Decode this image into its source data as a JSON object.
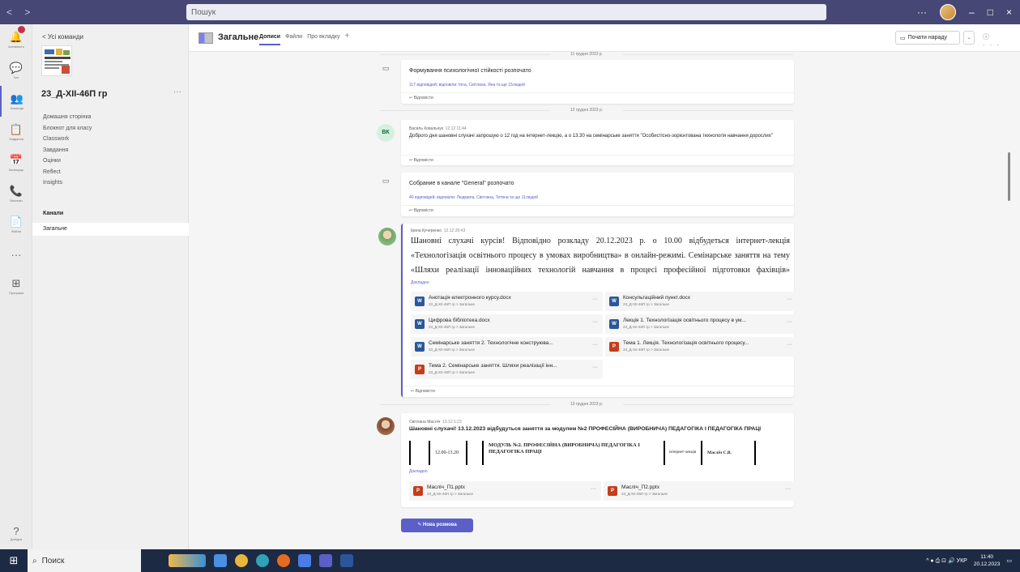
{
  "titlebar": {
    "nav": "< >",
    "search_placeholder": "Пошук",
    "more": "···",
    "min": "–",
    "max": "□",
    "close": "×"
  },
  "rail": {
    "items": [
      {
        "icon": "bell-icon",
        "glyph": "🔔",
        "label": "Активність"
      },
      {
        "icon": "chat-icon",
        "glyph": "💬",
        "label": "Чат"
      },
      {
        "icon": "teams-icon",
        "glyph": "👥",
        "label": "Команди"
      },
      {
        "icon": "assignments-icon",
        "glyph": "📋",
        "label": "Завдання"
      },
      {
        "icon": "calendar-icon",
        "glyph": "📅",
        "label": "Календар"
      },
      {
        "icon": "calls-icon",
        "glyph": "📞",
        "label": "Виклики"
      },
      {
        "icon": "files-icon",
        "glyph": "📄",
        "label": "Файли"
      },
      {
        "icon": "more-icon",
        "glyph": "···",
        "label": ""
      },
      {
        "icon": "apps-icon",
        "glyph": "⊞",
        "label": "Програми"
      }
    ],
    "help_glyph": "?",
    "help_label": "Довідка"
  },
  "sidebar": {
    "back": "< Усі команди",
    "team_name": "23_Д-ХІІ-46П гр",
    "more": "···",
    "items": [
      "Домашня сторінка",
      "Блокнот для класу",
      "Classwork",
      "Завдання",
      "Оцінки",
      "Reflect",
      "Insights"
    ],
    "channels_label": "Канали",
    "channel": "Загальне"
  },
  "header": {
    "title": "Загальне",
    "tabs": [
      "Дописи",
      "Файли",
      "Про вкладку"
    ],
    "add": "+",
    "meet": "Почати нараду",
    "drop": "⌄",
    "icons": "ⓘ ···"
  },
  "feed": {
    "dates": [
      "11 грудня 2023 р.",
      "12 грудня 2023 р.",
      "13 грудня 2023 р."
    ],
    "reply_label": "↩ Відповісти",
    "posts": [
      {
        "title": "Формування психологічної стійкості розпочато",
        "link": "117 відповідей; відповіли: Inna, Світлана, Яна та ще 15людей"
      },
      {
        "initials": "ВК",
        "author": "Василь Ковальчук",
        "time": "12.12 11:44",
        "text": "Доброго дня шановні слухачі запрошую о 12 год на інтернет-лекцію, а о 13.30 на семінарське заняття \"Особистісно-зорієнтована технологія навчання дорослих\""
      },
      {
        "title": "Собрание в канале \"General\" розпочато",
        "link": "40 відповідей; відповіли: Людмила, Світлана, Тетяна та ще 11людей"
      },
      {
        "author": "Ірина Кучеренко",
        "time": "12.12 20:43",
        "text": "Шановні слухачі курсів! Відповідно розкладу 20.12.2023 р. о 10.00 відбудеться інтернет-лекція «Технологізація освітнього процесу в умовах виробництва» в онлайн-режимі. Семінарське заняття на тему «Шляхи реалізації інноваційних технологій навчання в процесі професійної підготовки фахівців» відбудеться",
        "more": "Докладно",
        "files": [
          {
            "name": "Анотація електронного курсу.docx",
            "type": "W"
          },
          {
            "name": "Консультаційний пункт.docx",
            "type": "W"
          },
          {
            "name": "Цифрова бібліотека.docx",
            "type": "W"
          },
          {
            "name": "Лекція 1. Технологізація освітнього процесу в ум...",
            "type": "W"
          },
          {
            "name": "Семінарське заняття 2. Технологічне конструюва...",
            "type": "W"
          },
          {
            "name": "Тема 1. Лекція. Технологізація освітнього процесу...",
            "type": "P"
          },
          {
            "name": "Тема 2. Семінарське заняття. Шляхи реалізації інн...",
            "type": "P"
          }
        ],
        "file_path": "23_Д-ХІІ-46П гр > Загальне"
      },
      {
        "author": "Світлана Масліч",
        "time": "13.12 1:23",
        "text": "Шановні слухачі! 13.12.2023 відбудуться заняття за модулем №2 ПРОФЕСІЙНА (ВИРОБНИЧА) ПЕДАГОГІКА І ПЕДАГОГІКА ПРАЦІ",
        "scan": {
          "time": "12.00-13.20",
          "module": "МОДУЛЬ №2. ПРОФЕСІЙНА (ВИРОБНИЧА) ПЕДАГОГІКА І ПЕДАГОГІКА ПРАЦІ",
          "type": "інтернет-лекція",
          "teacher": "Масліч С.В."
        },
        "more": "Докладно",
        "files": [
          {
            "name": "Масліч_П1.pptx",
            "type": "P"
          },
          {
            "name": "Масліч_П2.pptx",
            "type": "P"
          }
        ]
      }
    ],
    "new_conversation": "Нова розмова"
  },
  "taskbar": {
    "search": "Поиск",
    "tray": "^ ● ⎙ ⊡ 🔊 УКР",
    "time": "11:40",
    "date": "20.12.2023"
  },
  "colors": {
    "accent": "#5b5fc7",
    "titlebar": "#464775",
    "taskbar": "#1d2a44"
  }
}
